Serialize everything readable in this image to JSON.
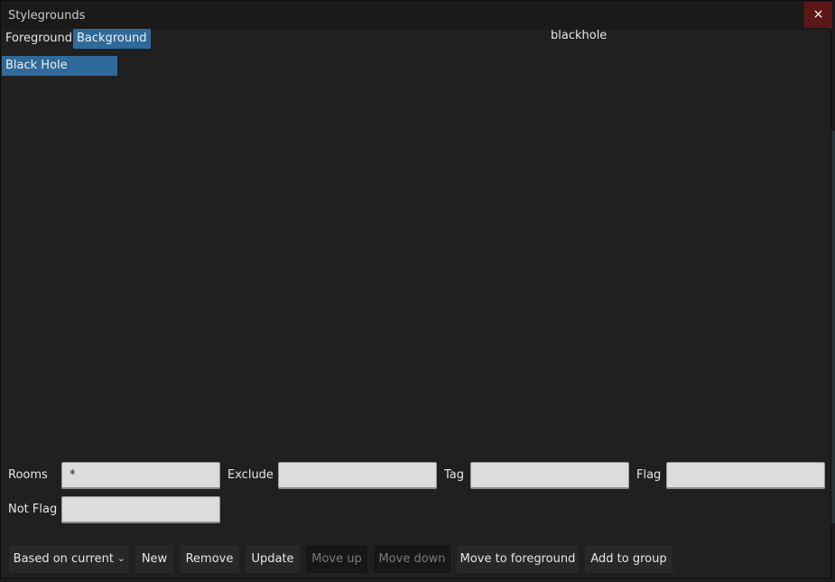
{
  "window": {
    "title": "Stylegrounds",
    "close_label": "×"
  },
  "tabs": [
    {
      "label": "Foreground",
      "selected": false
    },
    {
      "label": "Background",
      "selected": true
    }
  ],
  "preview": {
    "name": "blackhole"
  },
  "list": {
    "items": [
      {
        "label": "Black Hole",
        "selected": true
      }
    ]
  },
  "fields": {
    "rooms": {
      "label": "Rooms",
      "value": "*"
    },
    "exclude": {
      "label": "Exclude",
      "value": ""
    },
    "tag": {
      "label": "Tag",
      "value": ""
    },
    "flag": {
      "label": "Flag",
      "value": ""
    },
    "not_flag": {
      "label": "Not Flag",
      "value": ""
    }
  },
  "toolbar": {
    "based_on_current": "Based on current",
    "new": "New",
    "remove": "Remove",
    "update": "Update",
    "move_up": "Move up",
    "move_down": "Move down",
    "move_to_foreground": "Move to foreground",
    "add_to_group": "Add to group"
  },
  "colors": {
    "accent": "#2f6a9a",
    "close_bg": "#5e1717",
    "panel_bg": "#202020"
  },
  "icons": {
    "close": "close-icon",
    "dropdown": "chevron-down-icon"
  }
}
